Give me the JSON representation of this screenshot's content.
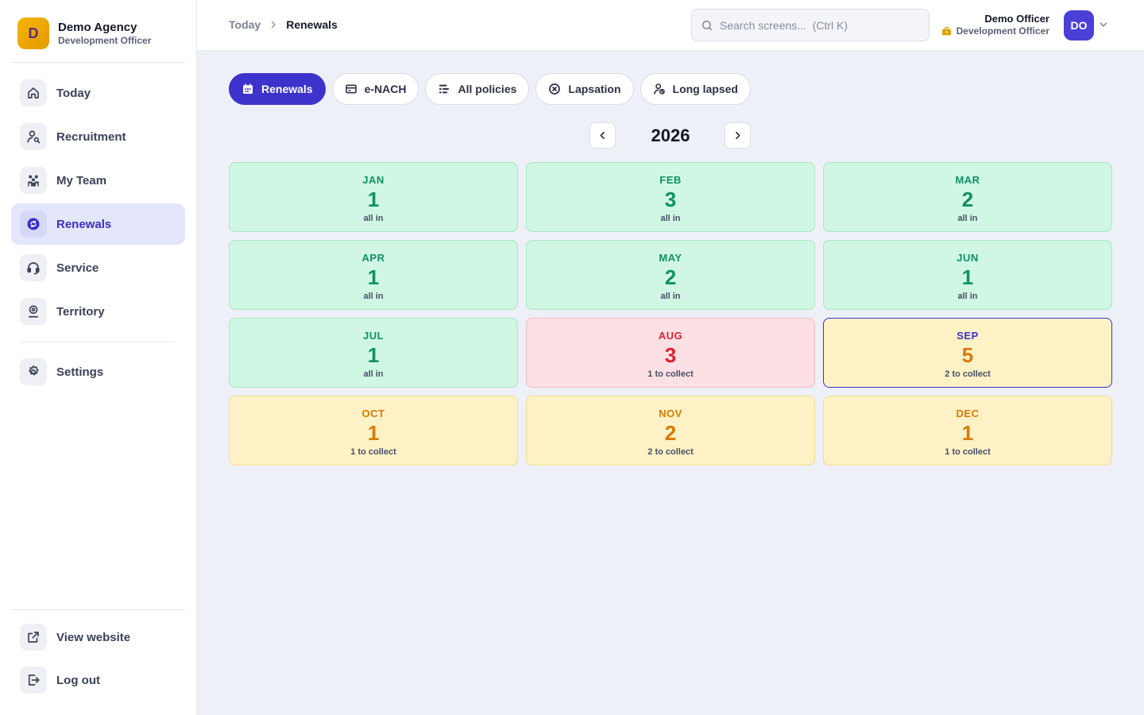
{
  "brand": {
    "logo_letter": "D",
    "name": "Demo Agency",
    "role": "Development Officer"
  },
  "sidebar": {
    "items": [
      {
        "label": "Today",
        "icon": "home-icon"
      },
      {
        "label": "Recruitment",
        "icon": "user-search-icon"
      },
      {
        "label": "My Team",
        "icon": "team-icon"
      },
      {
        "label": "Renewals",
        "icon": "renewals-icon",
        "active": true
      },
      {
        "label": "Service",
        "icon": "headset-icon"
      },
      {
        "label": "Territory",
        "icon": "location-icon"
      }
    ],
    "settings_label": "Settings",
    "view_website_label": "View website",
    "logout_label": "Log out"
  },
  "breadcrumb": {
    "root": "Today",
    "current": "Renewals"
  },
  "search": {
    "placeholder": "Search screens...  (Ctrl K)"
  },
  "user": {
    "name": "Demo Officer",
    "role": "Development Officer",
    "initials": "DO"
  },
  "tabs": [
    {
      "label": "Renewals",
      "icon": "calendar-icon",
      "active": true
    },
    {
      "label": "e-NACH",
      "icon": "card-icon"
    },
    {
      "label": "All policies",
      "icon": "list-icon"
    },
    {
      "label": "Lapsation",
      "icon": "x-circle-icon"
    },
    {
      "label": "Long lapsed",
      "icon": "user-clock-icon"
    }
  ],
  "year": "2026",
  "months": [
    {
      "month": "JAN",
      "count": "1",
      "status": "all in",
      "state": "green"
    },
    {
      "month": "FEB",
      "count": "3",
      "status": "all in",
      "state": "green"
    },
    {
      "month": "MAR",
      "count": "2",
      "status": "all in",
      "state": "green"
    },
    {
      "month": "APR",
      "count": "1",
      "status": "all in",
      "state": "green"
    },
    {
      "month": "MAY",
      "count": "2",
      "status": "all in",
      "state": "green"
    },
    {
      "month": "JUN",
      "count": "1",
      "status": "all in",
      "state": "green"
    },
    {
      "month": "JUL",
      "count": "1",
      "status": "all in",
      "state": "green"
    },
    {
      "month": "AUG",
      "count": "3",
      "status": "1 to collect",
      "state": "red"
    },
    {
      "month": "SEP",
      "count": "5",
      "status": "2 to collect",
      "state": "amber",
      "selected": true
    },
    {
      "month": "OCT",
      "count": "1",
      "status": "1 to collect",
      "state": "amber"
    },
    {
      "month": "NOV",
      "count": "2",
      "status": "2 to collect",
      "state": "amber"
    },
    {
      "month": "DEC",
      "count": "1",
      "status": "1 to collect",
      "state": "amber"
    }
  ],
  "colors": {
    "accent": "#3d33cc",
    "green": "#109163",
    "red": "#dd2233",
    "amber": "#d77a04"
  }
}
